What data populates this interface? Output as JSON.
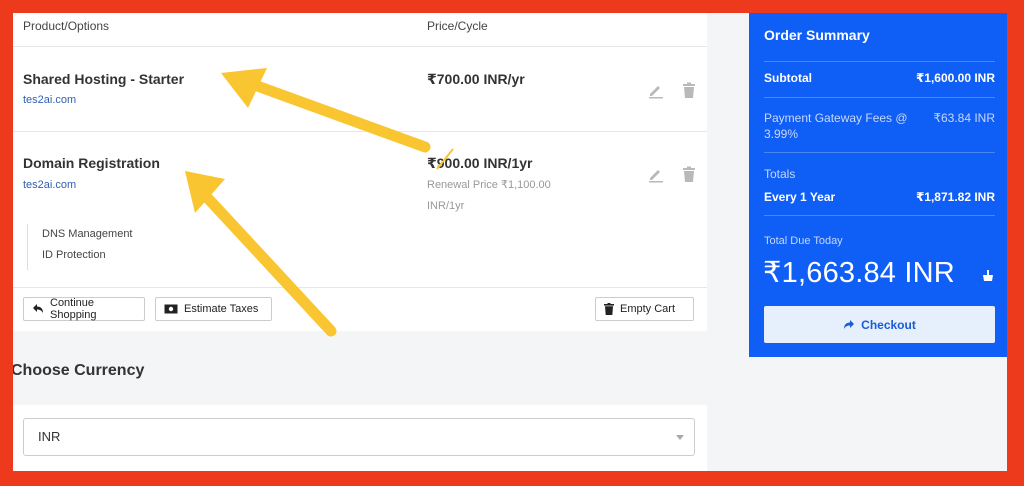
{
  "cart": {
    "header": {
      "product": "Product/Options",
      "price": "Price/Cycle"
    },
    "items": [
      {
        "name": "Shared Hosting - Starter",
        "domain": "tes2ai.com",
        "price": "₹700.00 INR/yr"
      },
      {
        "name": "Domain Registration",
        "domain": "tes2ai.com",
        "price": "₹900.00 INR/1yr",
        "renewal_line1": "Renewal Price ₹1,100.00",
        "renewal_line2": "INR/1yr",
        "addons": [
          "DNS Management",
          "ID Protection"
        ]
      }
    ],
    "buttons": {
      "continue": "Continue Shopping",
      "estimate": "Estimate Taxes",
      "empty": "Empty Cart"
    }
  },
  "currency": {
    "title": "Choose Currency",
    "selected": "INR"
  },
  "summary": {
    "title": "Order Summary",
    "subtotal_label": "Subtotal",
    "subtotal_value": "₹1,600.00 INR",
    "fees_label_line1": "Payment Gateway Fees @",
    "fees_label_line2": "3.99%",
    "fees_value": "₹63.84 INR",
    "totals_label": "Totals",
    "cycle_label": "Every 1 Year",
    "cycle_value": "₹1,871.82 INR",
    "due_label": "Total Due Today",
    "due_value": "₹1,663.84 INR",
    "checkout_label": "Checkout"
  },
  "colors": {
    "accent": "#0f5ef5",
    "border": "#ee3a1c",
    "arrow": "#f9c531"
  },
  "icons": [
    "edit-icon",
    "trash-icon",
    "back-arrow-icon",
    "money-icon",
    "trash-icon",
    "chevron-down-icon",
    "hand-icon",
    "arrow-right-icon"
  ]
}
